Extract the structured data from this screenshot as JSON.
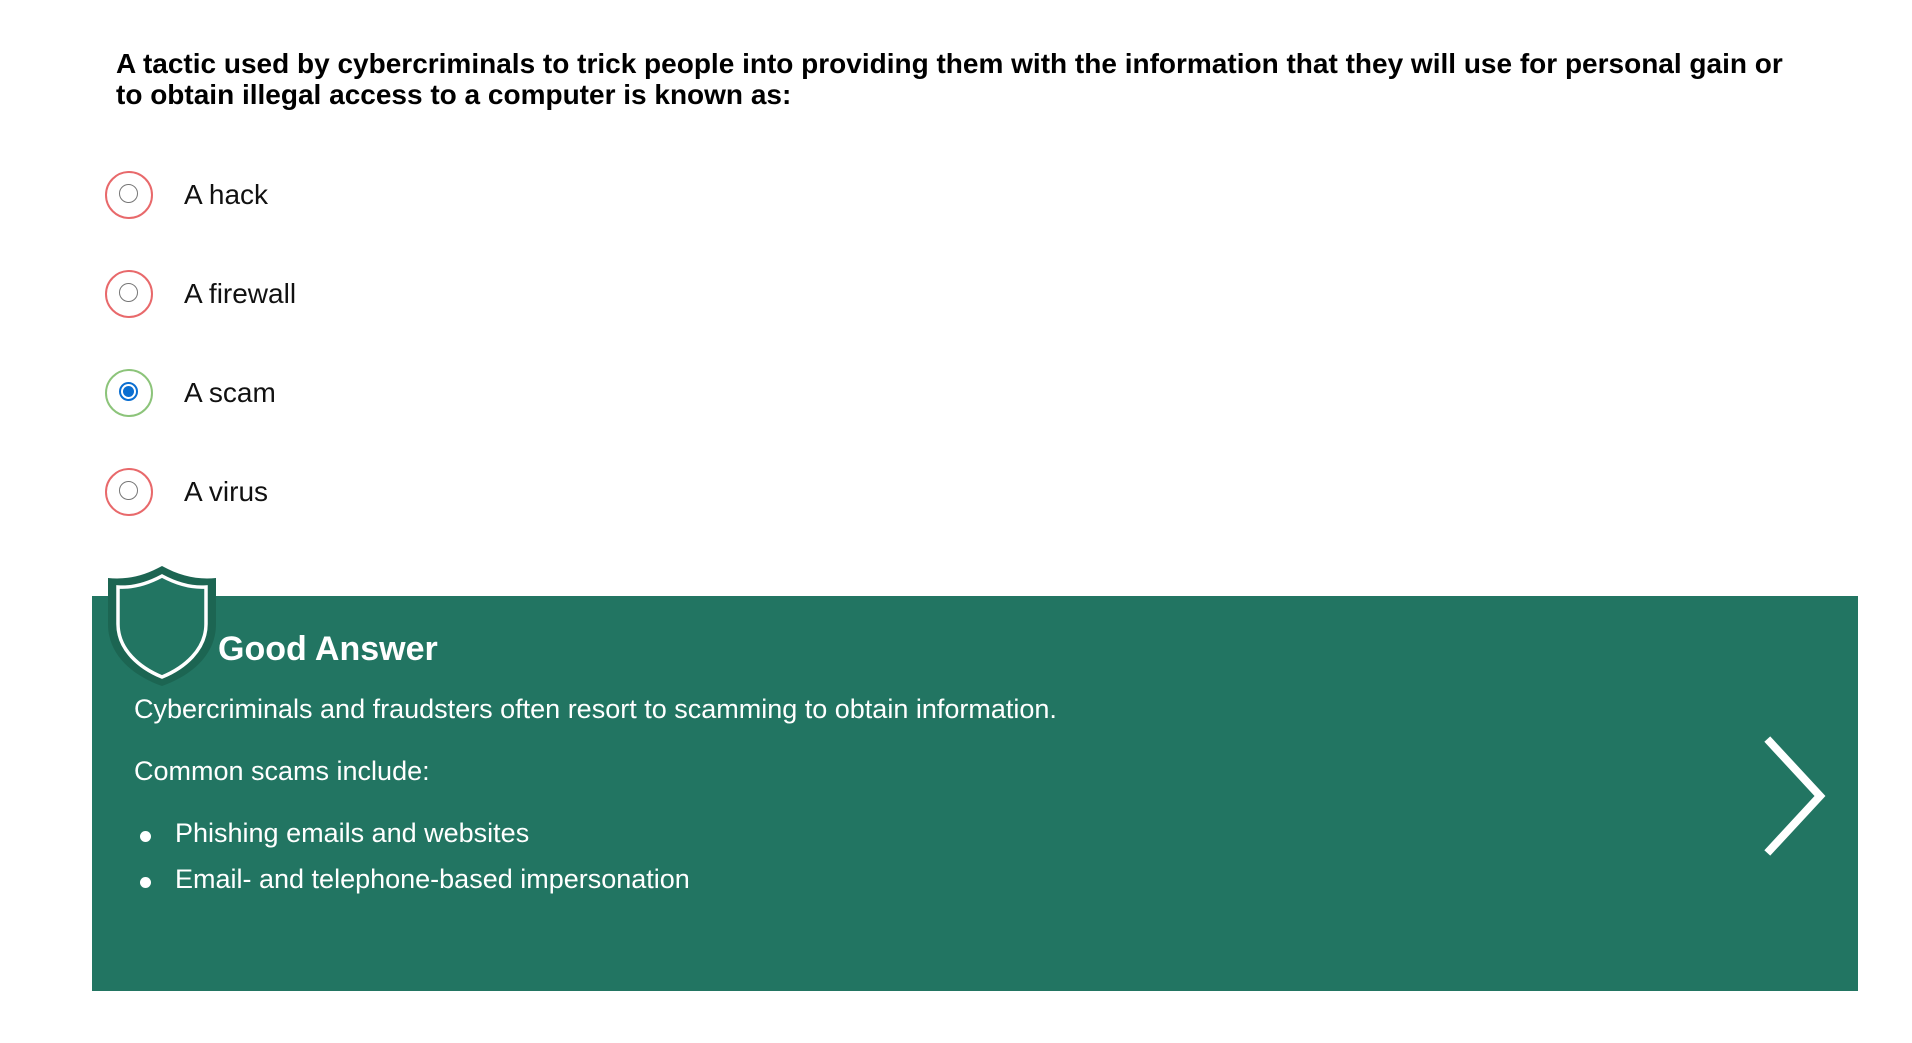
{
  "question": {
    "text": "A tactic used by cybercriminals to trick people into providing them with the information that they will use for personal gain or to obtain illegal access to a computer is known as:"
  },
  "options": [
    {
      "label": "A hack",
      "selected": false,
      "correct": false
    },
    {
      "label": "A firewall",
      "selected": false,
      "correct": false
    },
    {
      "label": "A scam",
      "selected": true,
      "correct": true
    },
    {
      "label": "A virus",
      "selected": false,
      "correct": false
    }
  ],
  "feedback": {
    "title": "Good Answer",
    "text": "Cybercriminals and fraudsters often resort to scamming to obtain information.",
    "subtitle": "Common scams include:",
    "items": [
      "Phishing emails and websites",
      "Email- and telephone-based impersonation"
    ],
    "next_icon": "chevron-right-icon",
    "shield_icon": "shield-icon"
  },
  "colors": {
    "feedback_bg": "#227562",
    "wrong_ring": "#e8696b",
    "correct_ring": "#8cc47a",
    "radio_checked": "#0a6ed1"
  }
}
